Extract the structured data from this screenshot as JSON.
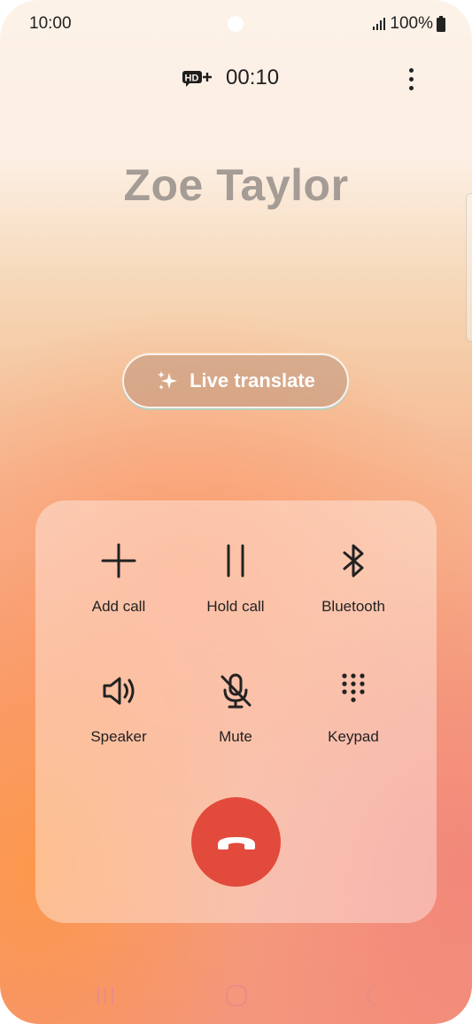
{
  "status_bar": {
    "time": "10:00",
    "battery": "100%",
    "icons": [
      "signal-icon",
      "battery-icon"
    ]
  },
  "call": {
    "hd_badge": "HD+",
    "timer": "00:10",
    "contact_name": "Zoe Taylor"
  },
  "live_translate": {
    "label": "Live translate",
    "icon": "sparkle-icon"
  },
  "controls": [
    {
      "label": "Add call",
      "icon": "plus-icon"
    },
    {
      "label": "Hold call",
      "icon": "pause-icon"
    },
    {
      "label": "Bluetooth",
      "icon": "bluetooth-icon"
    },
    {
      "label": "Speaker",
      "icon": "speaker-icon"
    },
    {
      "label": "Mute",
      "icon": "mic-off-icon"
    },
    {
      "label": "Keypad",
      "icon": "keypad-icon"
    }
  ],
  "end_call": {
    "icon": "end-call-icon",
    "color": "#e24a3b"
  },
  "nav": {
    "icons": [
      "recent-apps-icon",
      "home-icon",
      "back-icon"
    ]
  },
  "colors": {
    "contact_name": "#a59c96",
    "end_call": "#e24a3b"
  }
}
